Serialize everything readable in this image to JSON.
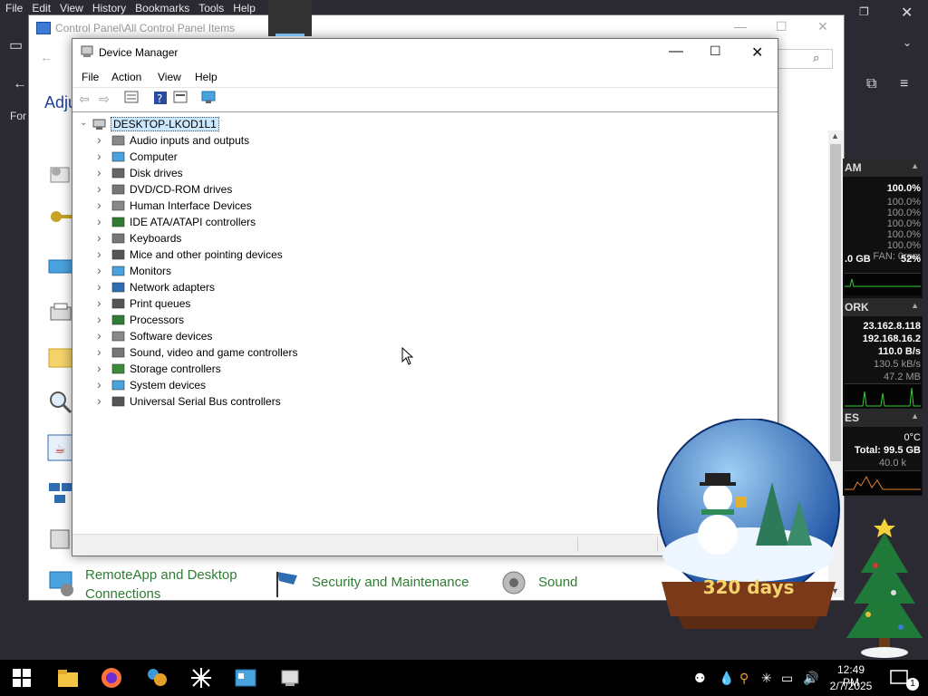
{
  "background_browser": {
    "menu": [
      "File",
      "Edit",
      "View",
      "History",
      "Bookmarks",
      "Tools",
      "Help"
    ],
    "partial_heading": "Adju",
    "partial_text": "For"
  },
  "control_panel": {
    "title": "Control Panel\\All Control Panel Items",
    "items": [
      {
        "label": "RemoteApp and Desktop Connections",
        "icon": "remoteapp-icon"
      },
      {
        "label": "Security and Maintenance",
        "icon": "security-flag-icon"
      },
      {
        "label": "Sound",
        "icon": "speaker-icon"
      }
    ]
  },
  "device_manager": {
    "title": "Device Manager",
    "menu": [
      "File",
      "Action",
      "View",
      "Help"
    ],
    "toolbar": [
      "back-arrow-icon",
      "forward-arrow-icon",
      "properties-icon",
      "help-icon",
      "update-driver-icon",
      "scan-hardware-icon"
    ],
    "root": "DESKTOP-LKOD1L1",
    "categories": [
      {
        "label": "Audio inputs and outputs",
        "icon": "speaker-icon"
      },
      {
        "label": "Computer",
        "icon": "computer-icon"
      },
      {
        "label": "Disk drives",
        "icon": "disk-drive-icon"
      },
      {
        "label": "DVD/CD-ROM drives",
        "icon": "dvd-drive-icon"
      },
      {
        "label": "Human Interface Devices",
        "icon": "hid-icon"
      },
      {
        "label": "IDE ATA/ATAPI controllers",
        "icon": "ide-controller-icon"
      },
      {
        "label": "Keyboards",
        "icon": "keyboard-icon"
      },
      {
        "label": "Mice and other pointing devices",
        "icon": "mouse-icon"
      },
      {
        "label": "Monitors",
        "icon": "monitor-icon"
      },
      {
        "label": "Network adapters",
        "icon": "network-adapter-icon"
      },
      {
        "label": "Print queues",
        "icon": "printer-icon"
      },
      {
        "label": "Processors",
        "icon": "processor-icon"
      },
      {
        "label": "Software devices",
        "icon": "software-device-icon"
      },
      {
        "label": "Sound, video and game controllers",
        "icon": "sound-controller-icon"
      },
      {
        "label": "Storage controllers",
        "icon": "storage-controller-icon"
      },
      {
        "label": "System devices",
        "icon": "system-device-icon"
      },
      {
        "label": "Universal Serial Bus controllers",
        "icon": "usb-icon"
      }
    ]
  },
  "monitor_widget": {
    "ram_header": "AM",
    "ram_total": "100.0%",
    "ram_rows": [
      "100.0%",
      "100.0%",
      "100.0%",
      "100.0%",
      "100.0%"
    ],
    "fan": "FAN: 0rpm",
    "mem_used": ".0 GB",
    "mem_pct": "52%",
    "network_header": "ORK",
    "ip_public": "23.162.8.118",
    "ip_local": "192.168.16.2",
    "net_down": "110.0 B/s",
    "net_up": "130.5 kB/s",
    "net_total": "47.2 MB",
    "drives_header": "ES",
    "temp": "0°C",
    "drive_total": "Total: 99.5 GB",
    "drive_rate": "40.0 k"
  },
  "snow_globe": {
    "counter": "320 days"
  },
  "taskbar": {
    "apps": [
      "windows-start-icon",
      "file-explorer-icon",
      "firefox-icon",
      "app-icon",
      "sparkle-app-icon",
      "control-panel-icon",
      "device-manager-icon"
    ],
    "time": "12:49 PM",
    "date": "2/7/2025",
    "notifications": "1"
  },
  "colors": {
    "accent": "#0078d7",
    "link_green": "#2e7d32",
    "selection": "#cce8ff"
  }
}
